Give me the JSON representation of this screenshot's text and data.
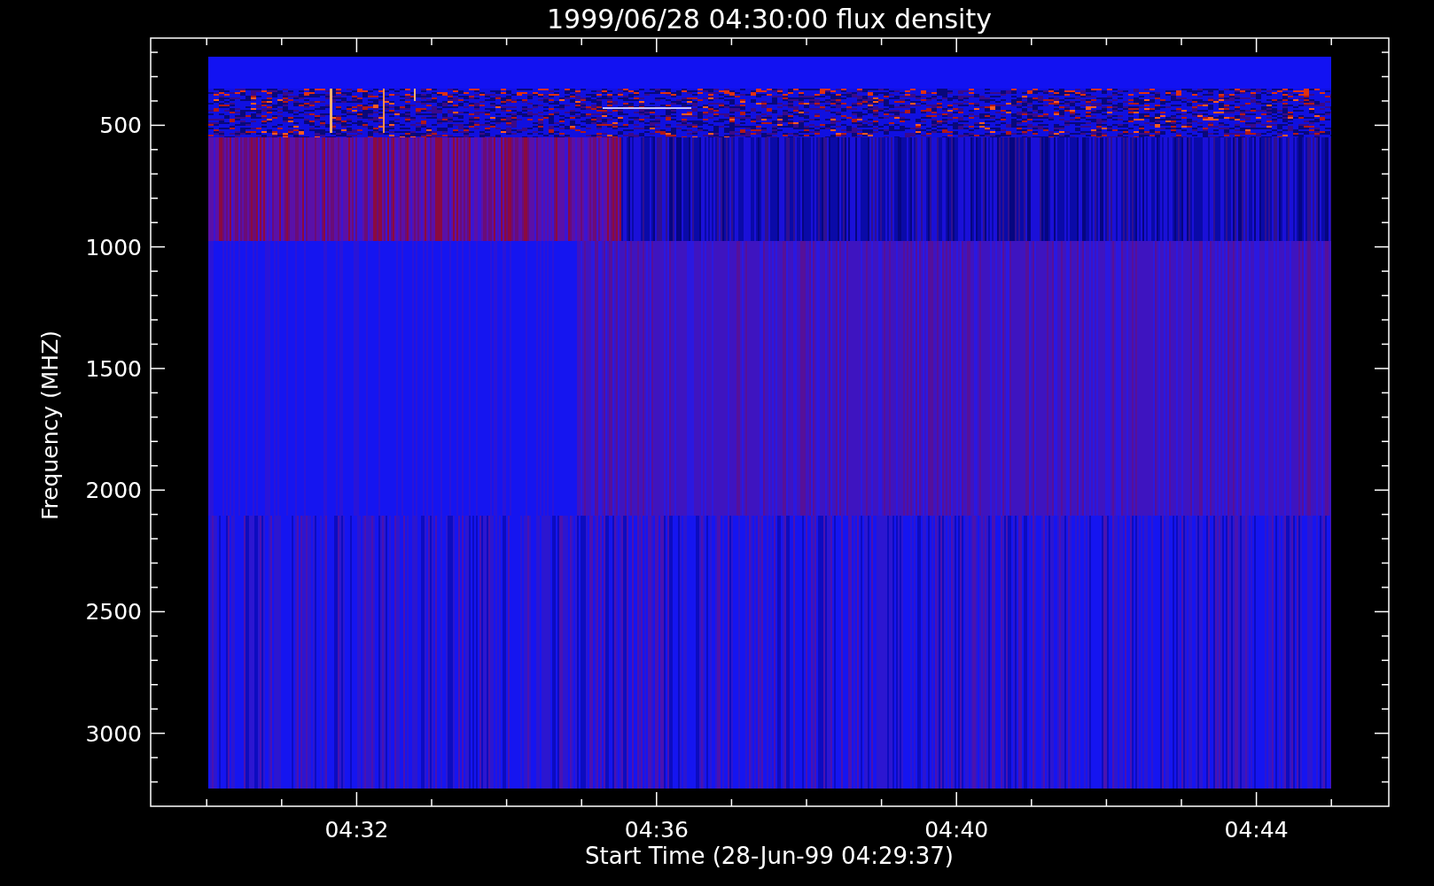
{
  "title": "1999/06/28 04:30:00 flux density",
  "y_axis": {
    "label": "Frequency (MHZ)",
    "ticks": [
      "500",
      "1000",
      "1500",
      "2000",
      "2500",
      "3000"
    ]
  },
  "x_axis": {
    "label": "Start Time (28-Jun-99 04:29:37)",
    "ticks": [
      "04:32",
      "04:36",
      "04:40",
      "04:44"
    ]
  }
}
